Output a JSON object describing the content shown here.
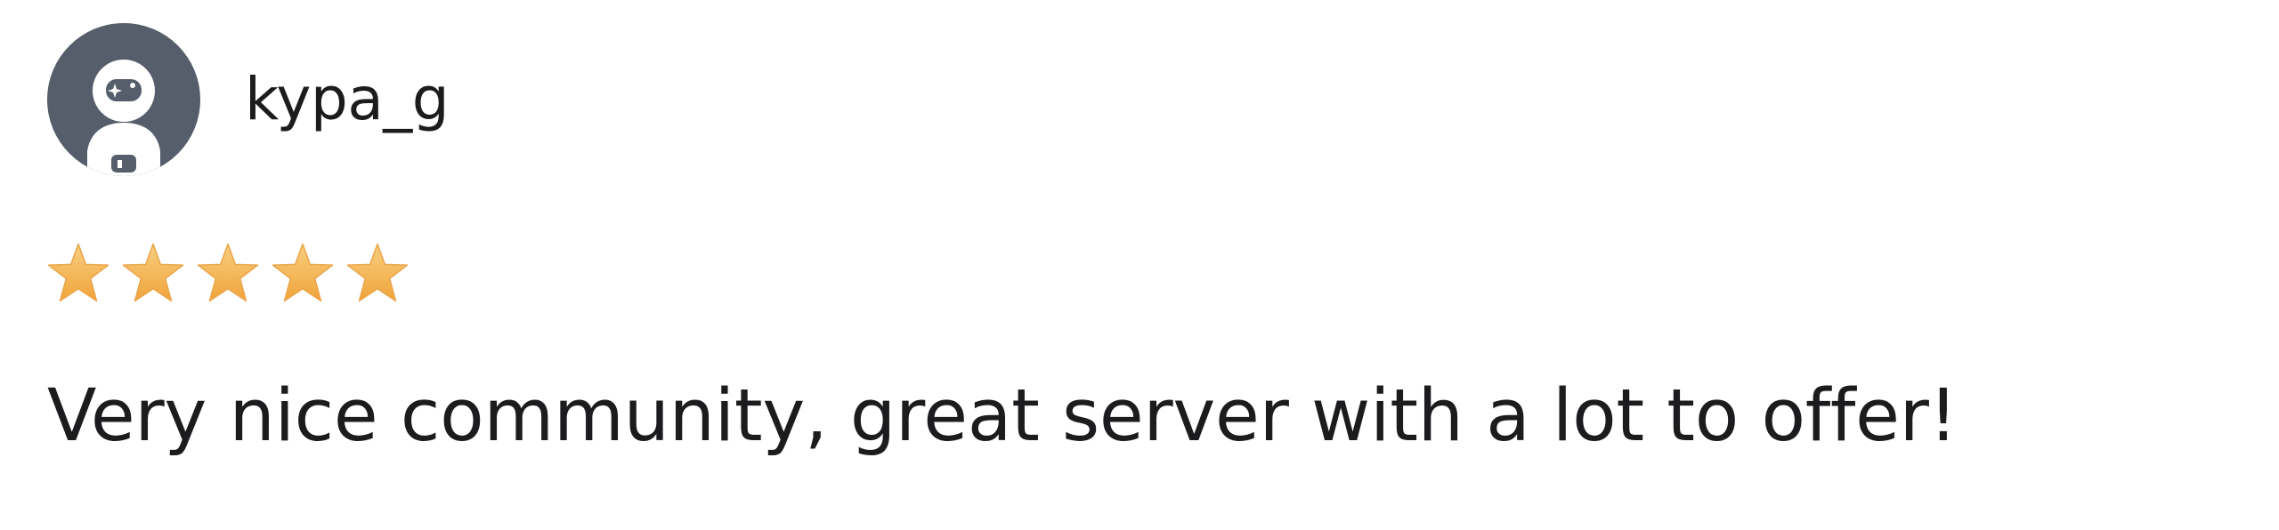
{
  "review": {
    "author": {
      "username": "kypa_g",
      "avatar_icon": "astronaut-avatar-icon"
    },
    "rating": {
      "value": 5,
      "max": 5,
      "star_icon": "star-icon",
      "star_color": "#f4b24e"
    },
    "text": "Very nice community, great server with a lot to offer!"
  },
  "colors": {
    "avatar_background": "#555e6a",
    "text": "#1c1c1f",
    "background": "#ffffff"
  }
}
